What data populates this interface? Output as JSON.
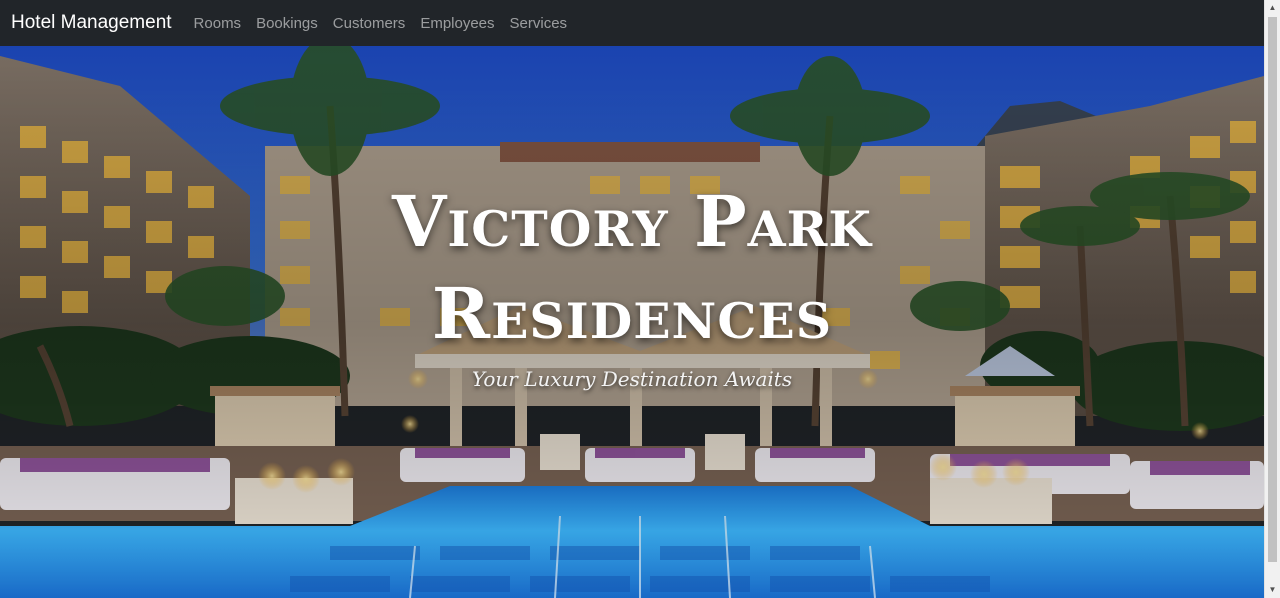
{
  "navbar": {
    "brand": "Hotel Management",
    "links": [
      "Rooms",
      "Bookings",
      "Customers",
      "Employees",
      "Services"
    ]
  },
  "hero": {
    "title_line1": "Victory Park",
    "title_line2": "Residences",
    "subtitle": "Your Luxury Destination Awaits"
  },
  "colors": {
    "navbar_bg": "#212529",
    "sky": "#2a5bd7",
    "pool": "#3db8ff"
  }
}
